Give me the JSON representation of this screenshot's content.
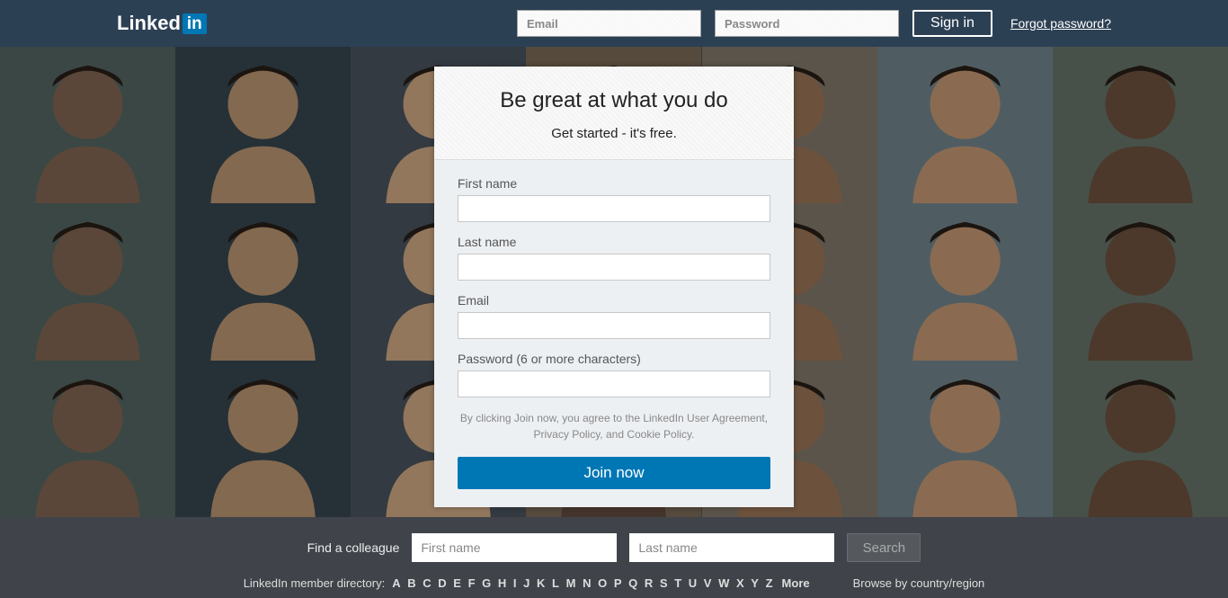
{
  "header": {
    "logo_text": "Linked",
    "logo_suffix": "in",
    "email_placeholder": "Email",
    "password_placeholder": "Password",
    "signin_label": "Sign in",
    "forgot_label": "Forgot password?"
  },
  "signup": {
    "heading": "Be great at what you do",
    "subheading": "Get started - it's free.",
    "first_name_label": "First name",
    "last_name_label": "Last name",
    "email_label": "Email",
    "password_label": "Password (6 or more characters)",
    "legal_text": "By clicking Join now, you agree to the LinkedIn User Agreement, Privacy Policy, and Cookie Policy.",
    "join_label": "Join now"
  },
  "colleague": {
    "prompt": "Find a colleague",
    "first_placeholder": "First name",
    "last_placeholder": "Last name",
    "search_label": "Search"
  },
  "directory": {
    "prefix": "LinkedIn member directory:",
    "letters": [
      "A",
      "B",
      "C",
      "D",
      "E",
      "F",
      "G",
      "H",
      "I",
      "J",
      "K",
      "L",
      "M",
      "N",
      "O",
      "P",
      "Q",
      "R",
      "S",
      "T",
      "U",
      "V",
      "W",
      "X",
      "Y",
      "Z"
    ],
    "more": "More",
    "browse": "Browse by country/region"
  }
}
